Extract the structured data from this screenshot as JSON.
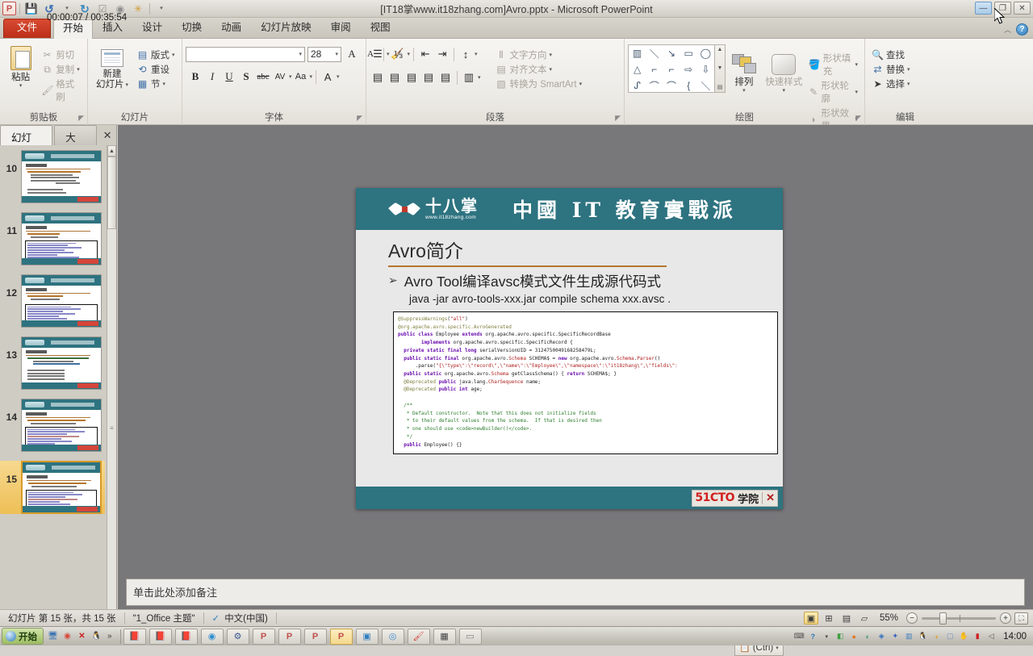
{
  "window": {
    "title": "[IT18掌www.it18zhang.com]Avro.pptx  -  Microsoft PowerPoint",
    "minimize": "—",
    "restore": "❐",
    "close": "✕",
    "help": "?",
    "collapse_ribbon": "︿"
  },
  "quick_access": {
    "app_logo": "P",
    "items": [
      {
        "name": "save-icon",
        "glyph": "💾"
      },
      {
        "name": "undo-icon",
        "glyph": "↺"
      },
      {
        "name": "undo-dropdown-icon",
        "glyph": "▾"
      },
      {
        "name": "redo-icon",
        "glyph": "↻"
      },
      {
        "name": "check-icon",
        "glyph": "☑"
      },
      {
        "name": "record-icon",
        "glyph": "◉"
      },
      {
        "name": "screenshot-icon",
        "glyph": "✳"
      },
      {
        "name": "customize-qat-icon",
        "glyph": "▾"
      }
    ]
  },
  "ribbon_tabs": [
    {
      "label": "文件",
      "type": "file"
    },
    {
      "label": "开始",
      "active": true
    },
    {
      "label": "插入"
    },
    {
      "label": "设计"
    },
    {
      "label": "切换"
    },
    {
      "label": "动画"
    },
    {
      "label": "幻灯片放映"
    },
    {
      "label": "审阅"
    },
    {
      "label": "视图"
    }
  ],
  "ribbon": {
    "clipboard": {
      "group_label": "剪贴板",
      "paste": "粘贴",
      "paste_arrow": "▾",
      "cut": "剪切",
      "copy": "复制",
      "format_painter": "格式刷",
      "copy_arrow": "▾"
    },
    "slides": {
      "group_label": "幻灯片",
      "new_slide_line1": "新建",
      "new_slide_line2": "幻灯片",
      "new_slide_arrow": "▾",
      "layout": "版式",
      "layout_arrow": "▾",
      "reset": "重设",
      "section": "节",
      "section_arrow": "▾"
    },
    "font": {
      "group_label": "字体",
      "font_name": "",
      "font_name_arrow": "▾",
      "font_size": "28",
      "font_size_arrow": "▾",
      "grow_font": "A",
      "shrink_font": "A",
      "clear_format": "A",
      "bold": "B",
      "italic": "I",
      "underline": "U",
      "shadow": "S",
      "strikethrough": "abc",
      "char_spacing": "AV",
      "change_case": "Aa",
      "font_color": "A"
    },
    "paragraph": {
      "group_label": "段落",
      "bullets": "☰",
      "numbering": "⅓",
      "decrease_indent": "⇤",
      "increase_indent": "⇥",
      "line_spacing": "↕",
      "align_left": "▤",
      "align_center": "▤",
      "align_right": "▤",
      "justify": "▤",
      "distribute": "▤",
      "columns": "▥",
      "text_direction": "文字方向",
      "align_text": "对齐文本",
      "convert_smartart": "转换为 SmartArt",
      "arrow": "▾"
    },
    "drawing": {
      "group_label": "绘图",
      "shapes": [
        "▥",
        "＼",
        "↘",
        "▭",
        "◯",
        "△",
        "⌐",
        "⌐",
        "⇨",
        "⇩",
        "ᔑ",
        "⌒",
        "⌒",
        "{",
        "＼"
      ],
      "scroll_up": "▲",
      "scroll_down": "▼",
      "scroll_more": "▤",
      "arrange": "排列",
      "quick_styles": "快速样式",
      "shape_fill": "形状填充",
      "shape_outline": "形状轮廓",
      "shape_effects": "形状效果",
      "arrow": "▾"
    },
    "editing": {
      "group_label": "编辑",
      "find": "查找",
      "replace": "替换",
      "select": "选择",
      "arrow": "▾"
    }
  },
  "slides_pane": {
    "tabs": [
      {
        "label": "幻灯片",
        "active": true
      },
      {
        "label": "大纲",
        "active": false
      }
    ],
    "close": "✕",
    "scroll_up": "▲",
    "scroll_down": "▼",
    "grip": "≡",
    "thumbnails": [
      {
        "number": "10",
        "selected": false,
        "has_code": false
      },
      {
        "number": "11",
        "selected": false,
        "has_code": true
      },
      {
        "number": "12",
        "selected": false,
        "has_code": true
      },
      {
        "number": "13",
        "selected": false,
        "has_code": false
      },
      {
        "number": "14",
        "selected": false,
        "has_code": true
      },
      {
        "number": "15",
        "selected": true,
        "has_code": true
      }
    ]
  },
  "slide": {
    "brand_name": "十八掌",
    "brand_url": "www.it18zhang.com",
    "slogan": "中國 IT 教育實戰派",
    "title": "Avro简介",
    "bullet_marker": "➢",
    "bullet_text": "Avro Tool编译avsc模式文件生成源代码式",
    "bullet_sub": "java -jar avro-tools-xxx.jar compile schema xxx.avsc .",
    "footer_logo_red": "51CTO",
    "footer_logo_cn": "学院",
    "footer_logo_mark": "✕",
    "code_lines": [
      {
        "segments": [
          {
            "t": "@SuppressWarnings",
            "c": "c-ann"
          },
          {
            "t": "(",
            "c": "c-pl"
          },
          {
            "t": "\"all\"",
            "c": "c-str"
          },
          {
            "t": ")",
            "c": "c-pl"
          }
        ]
      },
      {
        "segments": [
          {
            "t": "@org.apache.avro.specific.AvroGenerated",
            "c": "c-ann"
          }
        ]
      },
      {
        "segments": [
          {
            "t": "public class ",
            "c": "c-kw"
          },
          {
            "t": "Employee ",
            "c": "c-pl"
          },
          {
            "t": "extends ",
            "c": "c-kw"
          },
          {
            "t": "org.apache.avro.specific.SpecificRecordBase",
            "c": "c-pl"
          }
        ]
      },
      {
        "segments": [
          {
            "t": "        implements ",
            "c": "c-kw"
          },
          {
            "t": "org.apache.avro.specific.SpecificRecord {",
            "c": "c-pl"
          }
        ]
      },
      {
        "segments": [
          {
            "t": "  private static final ",
            "c": "c-kw"
          },
          {
            "t": "long ",
            "c": "c-kw"
          },
          {
            "t": "serialVersionUID = ",
            "c": "c-pl"
          },
          {
            "t": "3124750049168258479L;",
            "c": "c-num"
          }
        ]
      },
      {
        "segments": [
          {
            "t": "  public static final ",
            "c": "c-kw"
          },
          {
            "t": "org.apache.avro.",
            "c": "c-pl"
          },
          {
            "t": "Schema",
            "c": "c-cls"
          },
          {
            "t": " SCHEMA$ = ",
            "c": "c-pl"
          },
          {
            "t": "new ",
            "c": "c-kw"
          },
          {
            "t": "org.apache.avro.",
            "c": "c-pl"
          },
          {
            "t": "Schema",
            "c": "c-cls"
          },
          {
            "t": ".",
            "c": "c-pl"
          },
          {
            "t": "Parser",
            "c": "c-cls"
          },
          {
            "t": "()",
            "c": "c-pl"
          }
        ]
      },
      {
        "segments": [
          {
            "t": "      .parse(",
            "c": "c-pl"
          },
          {
            "t": "\"{\\\"type\\\":\\\"record\\\",\\\"name\\\":\\\"Employee\\\",\\\"namespace\\\":\\\"it18zhang\\\",\\\"fields\\\":",
            "c": "c-str"
          }
        ]
      },
      {
        "segments": [
          {
            "t": "  public static ",
            "c": "c-kw"
          },
          {
            "t": "org.apache.avro.",
            "c": "c-pl"
          },
          {
            "t": "Schema",
            "c": "c-cls"
          },
          {
            "t": " getClassSchema() { ",
            "c": "c-pl"
          },
          {
            "t": "return ",
            "c": "c-kw"
          },
          {
            "t": "SCHEMA$; }",
            "c": "c-pl"
          }
        ]
      },
      {
        "segments": [
          {
            "t": "  @Deprecated ",
            "c": "c-ann"
          },
          {
            "t": "public ",
            "c": "c-kw"
          },
          {
            "t": "java.lang.",
            "c": "c-pl"
          },
          {
            "t": "CharSequence",
            "c": "c-cls"
          },
          {
            "t": " name;",
            "c": "c-pl"
          }
        ]
      },
      {
        "segments": [
          {
            "t": "  @Deprecated ",
            "c": "c-ann"
          },
          {
            "t": "public int ",
            "c": "c-kw"
          },
          {
            "t": "age;",
            "c": "c-pl"
          }
        ]
      },
      {
        "segments": [
          {
            "t": "",
            "c": "c-pl"
          }
        ]
      },
      {
        "segments": [
          {
            "t": "  /**",
            "c": "c-cmt"
          }
        ]
      },
      {
        "segments": [
          {
            "t": "   * Default constructor.  Note that this does not initialize fields",
            "c": "c-cmt"
          }
        ]
      },
      {
        "segments": [
          {
            "t": "   * to their default values from the schema.  If that is desired then",
            "c": "c-cmt"
          }
        ]
      },
      {
        "segments": [
          {
            "t": "   * one should use <code>newBuilder()</code>.",
            "c": "c-cmt"
          }
        ]
      },
      {
        "segments": [
          {
            "t": "   */",
            "c": "c-cmt"
          }
        ]
      },
      {
        "segments": [
          {
            "t": "  public ",
            "c": "c-kw"
          },
          {
            "t": "Employee() {}",
            "c": "c-pl"
          }
        ]
      }
    ]
  },
  "paste_options": {
    "label": "(Ctrl)",
    "arrow": "▾",
    "icon": "📋"
  },
  "notes": {
    "placeholder": "单击此处添加备注"
  },
  "status_bar": {
    "slide_count": "幻灯片 第 15 张，共 15 张",
    "theme": "\"1_Office 主题\"",
    "proofing_icon": "✓",
    "language": "中文(中国)",
    "recording_timer": "00:00:07 / 00:35:54",
    "zoom_level": "55%",
    "zoom_out": "−",
    "zoom_in": "+",
    "fit_window": "⛶",
    "views": [
      {
        "name": "normal-view",
        "glyph": "▣",
        "active": true
      },
      {
        "name": "slide-sorter-view",
        "glyph": "⊞",
        "active": false
      },
      {
        "name": "reading-view",
        "glyph": "▤",
        "active": false
      },
      {
        "name": "slideshow-view",
        "glyph": "▱",
        "active": false
      }
    ]
  },
  "taskbar": {
    "start_label": "开始",
    "quick_launch": [
      {
        "name": "show-desktop-icon",
        "glyph": "🖥",
        "color": "#3f78b5"
      },
      {
        "name": "chrome-icon",
        "glyph": "◉",
        "color": "#d9483b"
      },
      {
        "name": "close-red-x-icon",
        "glyph": "✕",
        "color": "#cc2222"
      },
      {
        "name": "qq-penguin-icon",
        "glyph": "🐧",
        "color": "#2b2b2b"
      }
    ],
    "overflow": "»",
    "task_buttons": [
      {
        "name": "taskbar-pdf-1",
        "glyph": "📕",
        "active": false
      },
      {
        "name": "taskbar-pdf-2",
        "glyph": "📕",
        "active": false
      },
      {
        "name": "taskbar-pdf-3",
        "glyph": "📕",
        "active": false
      },
      {
        "name": "taskbar-chrome",
        "glyph": "◉",
        "active": false
      },
      {
        "name": "taskbar-settings",
        "glyph": "⚙",
        "active": false
      },
      {
        "name": "taskbar-powerpoint-1",
        "glyph": "P",
        "active": false
      },
      {
        "name": "taskbar-powerpoint-2",
        "glyph": "P",
        "active": false
      },
      {
        "name": "taskbar-powerpoint-3",
        "glyph": "P",
        "active": false
      },
      {
        "name": "taskbar-powerpoint-4",
        "glyph": "P",
        "active": true
      },
      {
        "name": "taskbar-explorer",
        "glyph": "▣",
        "active": false
      },
      {
        "name": "taskbar-media",
        "glyph": "◎",
        "active": false
      },
      {
        "name": "taskbar-paint",
        "glyph": "🖌",
        "active": false
      },
      {
        "name": "taskbar-editor",
        "glyph": "▦",
        "active": false
      },
      {
        "name": "taskbar-misc",
        "glyph": "▭",
        "active": false
      }
    ],
    "tray": [
      {
        "name": "tray-keyboard-icon",
        "glyph": "⌨"
      },
      {
        "name": "tray-help-icon",
        "glyph": "?"
      },
      {
        "name": "tray-expand-icon",
        "glyph": "▾"
      },
      {
        "name": "tray-green-icon",
        "glyph": "◧"
      },
      {
        "name": "tray-orange-icon",
        "glyph": "●"
      },
      {
        "name": "tray-shield-icon",
        "glyph": "◐"
      },
      {
        "name": "tray-blue-icon",
        "glyph": "◈"
      },
      {
        "name": "tray-bluetooth-icon",
        "glyph": "✦"
      },
      {
        "name": "tray-network-icon",
        "glyph": "▥"
      },
      {
        "name": "tray-qq-icon",
        "glyph": "🐧"
      },
      {
        "name": "tray-sound-icon",
        "glyph": "◖"
      },
      {
        "name": "tray-monitor-icon",
        "glyph": "▢"
      },
      {
        "name": "tray-hand-icon",
        "glyph": "✋"
      },
      {
        "name": "tray-red-icon",
        "glyph": "▮"
      },
      {
        "name": "tray-volume-icon",
        "glyph": "◁"
      }
    ],
    "clock": "14:00"
  }
}
